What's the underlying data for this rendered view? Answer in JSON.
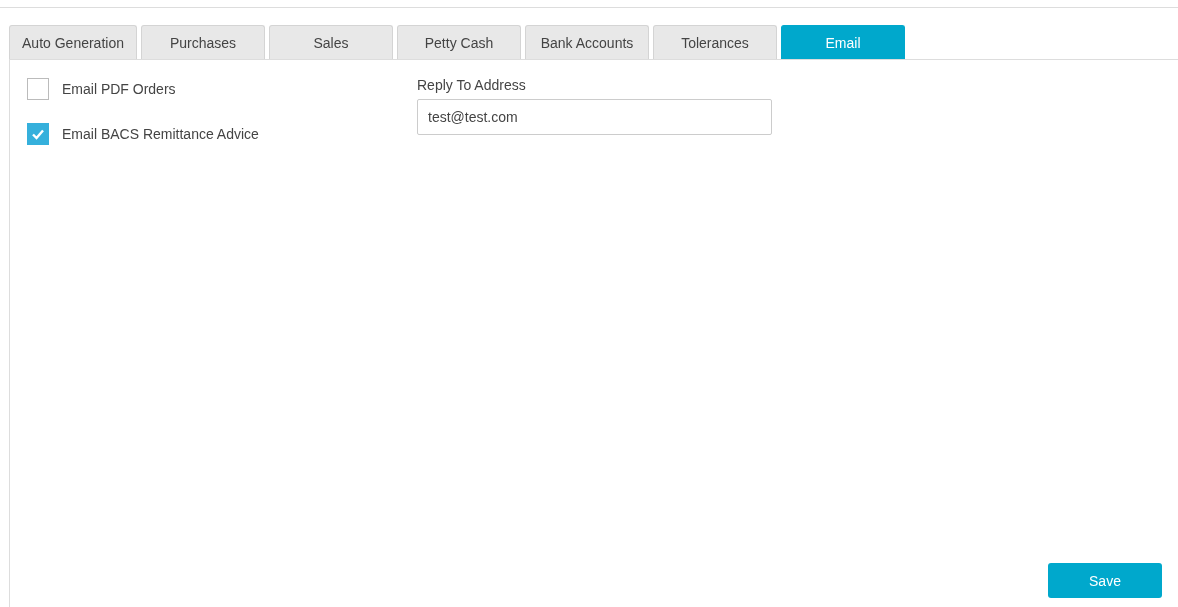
{
  "tabs": [
    {
      "label": "Auto Generation",
      "selected": false
    },
    {
      "label": "Purchases",
      "selected": false
    },
    {
      "label": "Sales",
      "selected": false
    },
    {
      "label": "Petty Cash",
      "selected": false
    },
    {
      "label": "Bank Accounts",
      "selected": false
    },
    {
      "label": "Tolerances",
      "selected": false
    },
    {
      "label": "Email",
      "selected": true
    }
  ],
  "options": [
    {
      "label": "Email PDF Orders",
      "checked": false
    },
    {
      "label": "Email BACS Remittance Advice",
      "checked": true
    }
  ],
  "reply_to": {
    "label": "Reply To Address",
    "value": "test@test.com"
  },
  "save_button": "Save"
}
